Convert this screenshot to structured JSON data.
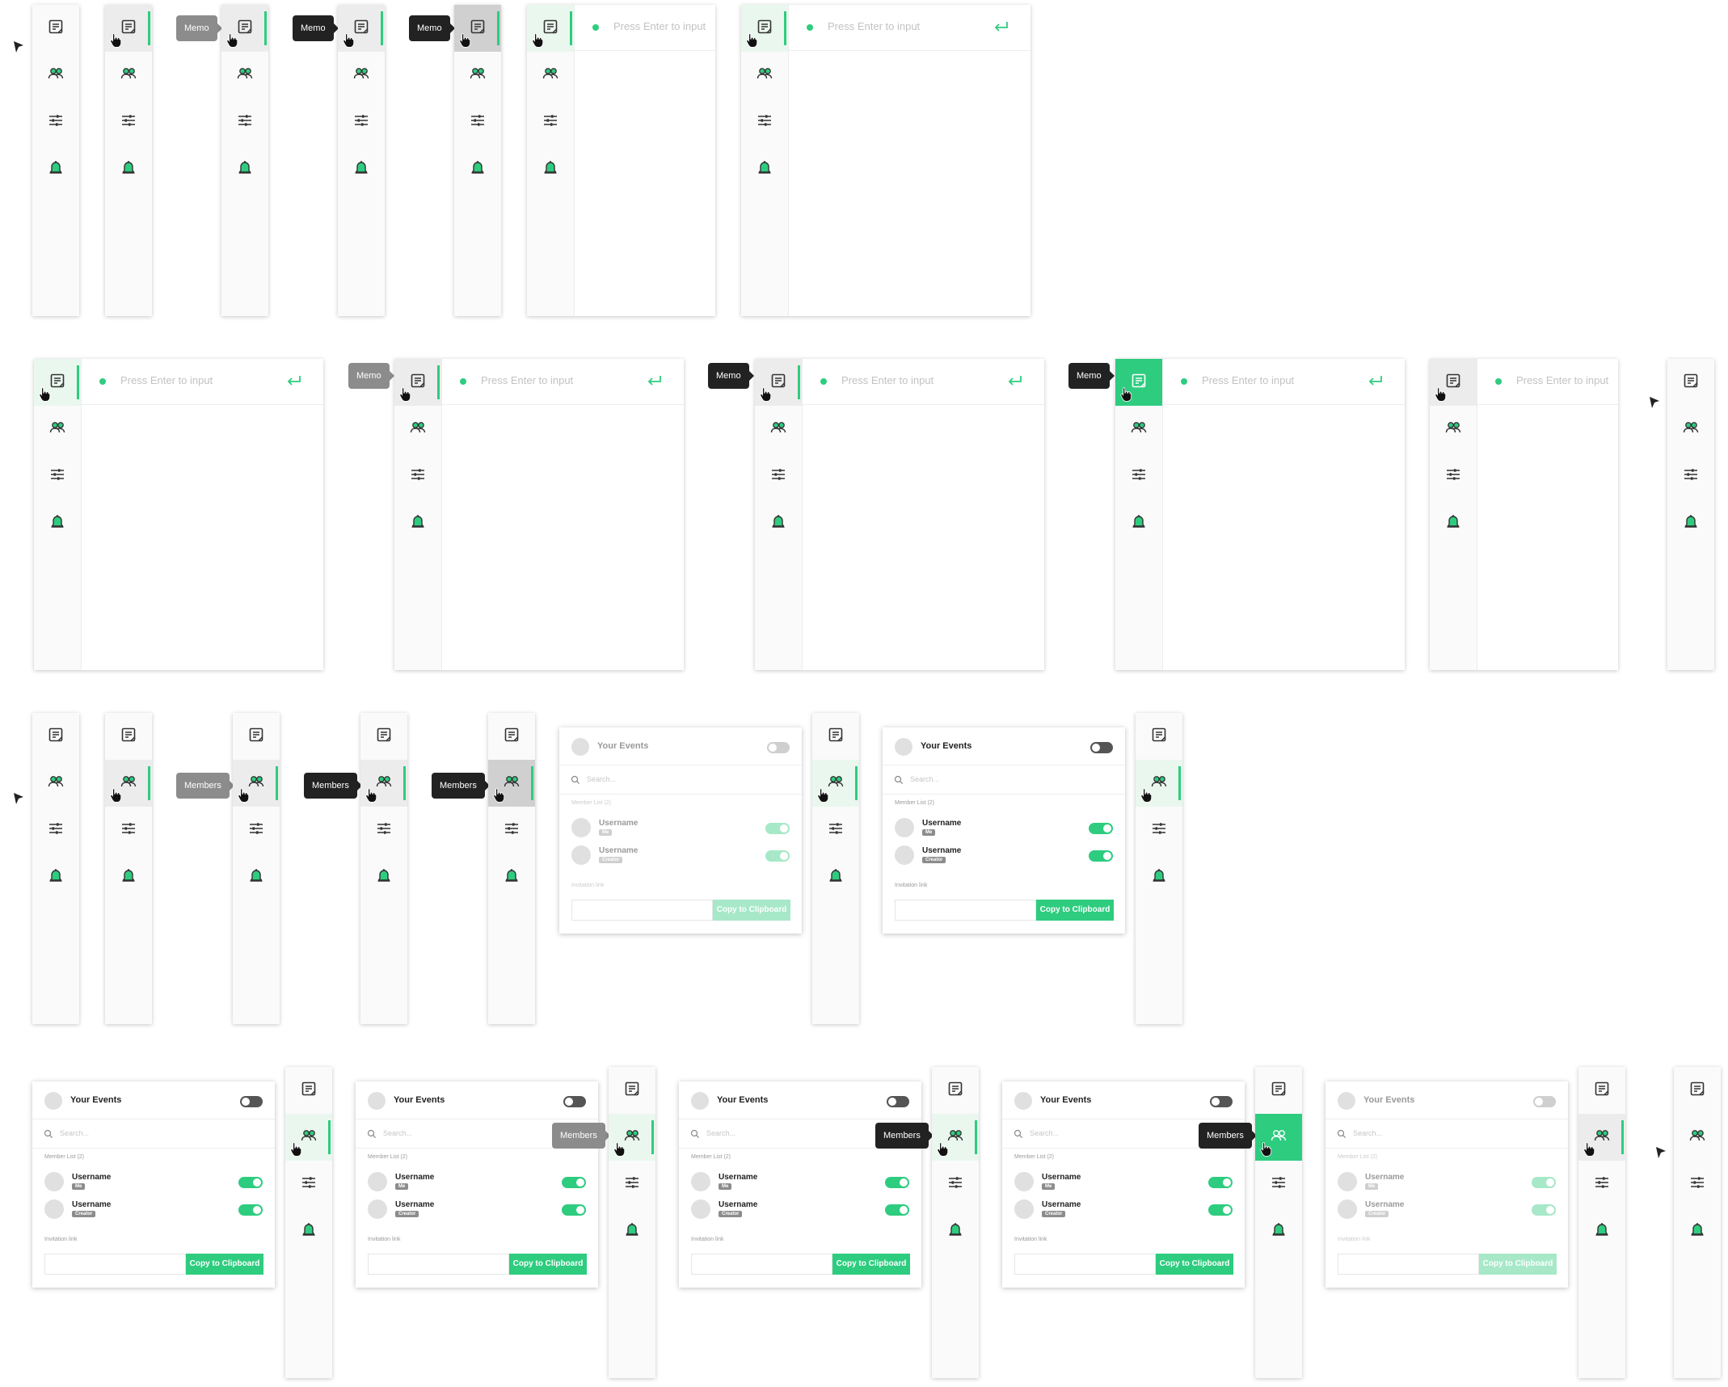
{
  "icons": [
    "memo-icon",
    "members-icon",
    "settings-sliders-icon",
    "notification-bell-icon"
  ],
  "colors": {
    "accent": "#2ecc7f",
    "accent_faded": "#a7e8c8",
    "tooltip_dark": "#222222",
    "tooltip_light": "#8c8c8c"
  },
  "memo": {
    "tooltip": "Memo",
    "placeholder": "Press Enter to input"
  },
  "members": {
    "tooltip": "Members",
    "title": "Your Events",
    "search_placeholder": "Search...",
    "member_list_label": "Member List (2)",
    "members": [
      {
        "name": "Username",
        "badge": "Me"
      },
      {
        "name": "Username",
        "badge": "Creator"
      }
    ],
    "invitation_label": "Invitation link",
    "copy_button": "Copy to Clipboard"
  }
}
